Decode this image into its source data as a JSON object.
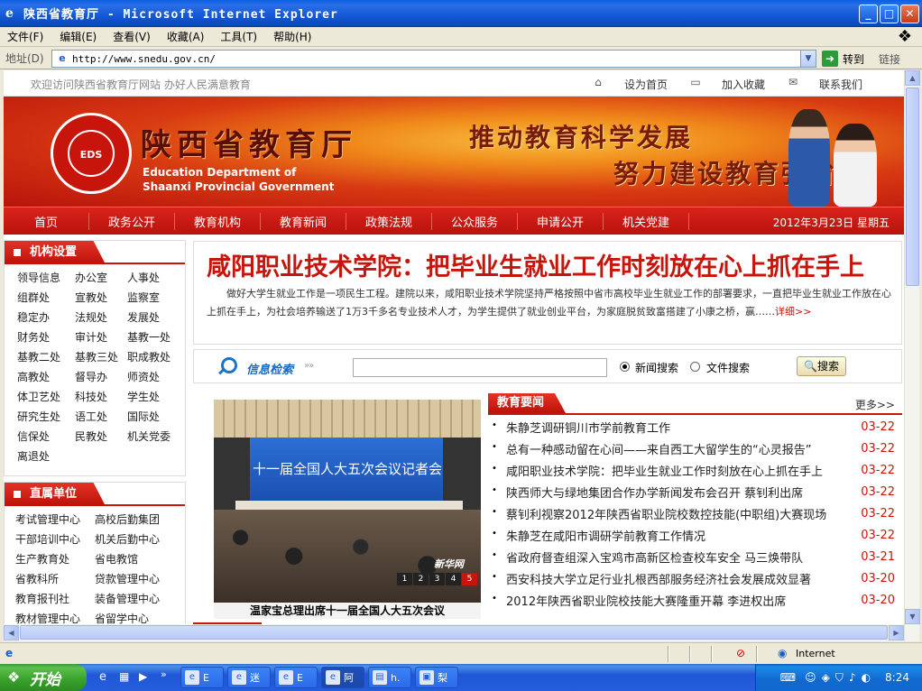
{
  "window": {
    "title": "陕西省教育厅 - Microsoft Internet Explorer",
    "menu": [
      "文件(F)",
      "编辑(E)",
      "查看(V)",
      "收藏(A)",
      "工具(T)",
      "帮助(H)"
    ],
    "address_label": "地址(D)",
    "url": "http://www.snedu.gov.cn/",
    "go_label": "转到",
    "links_label": "链接",
    "status_zone": "Internet"
  },
  "taskbar": {
    "start_label": "开始",
    "buttons": [
      {
        "icon": "ie-icon",
        "label": "E"
      },
      {
        "icon": "ie-icon",
        "label": "迷"
      },
      {
        "icon": "ie-icon",
        "label": "E"
      },
      {
        "icon": "ie-icon",
        "label": "阿"
      },
      {
        "icon": "doc-icon",
        "label": "h."
      },
      {
        "icon": "image-icon",
        "label": "梨"
      }
    ],
    "clock": "8:24"
  },
  "site": {
    "welcome": "欢迎访问陕西省教育厅网站 办好人民满意教育",
    "top_links": [
      "设为首页",
      "加入收藏",
      "联系我们"
    ],
    "name_cn": "陕西省教育厅",
    "name_en_line1": "Education Department of",
    "name_en_line2": "Shaanxi Provincial Government",
    "emblem_text": "EDS",
    "slogan_line1": "推动教育科学发展",
    "slogan_line2": "努力建设教育强省",
    "nav": [
      "首页",
      "政务公开",
      "教育机构",
      "教育新闻",
      "政策法规",
      "公众服务",
      "申请公开",
      "机关党建"
    ],
    "date": "2012年3月23日 星期五"
  },
  "sidebar": {
    "section1_title": "机构设置",
    "section1_items": [
      "领导信息",
      "办公室",
      "人事处",
      "组群处",
      "宣教处",
      "监察室",
      "稳定办",
      "法规处",
      "发展处",
      "财务处",
      "审计处",
      "基教一处",
      "基教二处",
      "基教三处",
      "职成教处",
      "高教处",
      "督导办",
      "师资处",
      "体卫艺处",
      "科技处",
      "学生处",
      "研究生处",
      "语工处",
      "国际处",
      "信保处",
      "民教处",
      "机关党委",
      "离退处"
    ],
    "section2_title": "直属单位",
    "section2_items": [
      "考试管理中心",
      "高校后勤集团",
      "干部培训中心",
      "机关后勤中心",
      "生产教育处",
      "省电教馆",
      "省教科所",
      "贷款管理中心",
      "教育报刊社",
      "装备管理中心",
      "教材管理中心",
      "省留学中心"
    ]
  },
  "headline": {
    "title": "咸阳职业技术学院：把毕业生就业工作时刻放在心上抓在手上",
    "summary": "做好大学生就业工作是一项民生工程。建院以来，咸阳职业技术学院坚持严格按照中省市高校毕业生就业工作的部署要求，一直把毕业生就业工作放在心上抓在手上，为社会培养输送了1万3千多名专业技术人才，为学生提供了就业创业平台，为家庭脱贫致富搭建了小康之桥，赢……",
    "more": "详细>>"
  },
  "search": {
    "label": "信息检索",
    "option1": "新闻搜索",
    "option2": "文件搜索",
    "button": "搜索"
  },
  "photo": {
    "backdrop_text": "十一届全国人大五次会议记者会",
    "watermark": "新华网",
    "pager": [
      "1",
      "2",
      "3",
      "4",
      "5"
    ],
    "caption": "温家宝总理出席十一届全国人大五次会议"
  },
  "news": {
    "title": "教育要闻",
    "more": "更多>>",
    "items": [
      {
        "title": "朱静芝调研铜川市学前教育工作",
        "date": "03-22"
      },
      {
        "title": "总有一种感动留在心间——来自西工大留学生的“心灵报告”",
        "date": "03-22"
      },
      {
        "title": "咸阳职业技术学院：把毕业生就业工作时刻放在心上抓在手上",
        "date": "03-22"
      },
      {
        "title": "陕西师大与绿地集团合作办学新闻发布会召开  蔡钊利出席",
        "date": "03-22"
      },
      {
        "title": "蔡钊利视察2012年陕西省职业院校数控技能(中职组)大赛现场",
        "date": "03-22"
      },
      {
        "title": "朱静芝在咸阳市调研学前教育工作情况",
        "date": "03-22"
      },
      {
        "title": "省政府督查组深入宝鸡市高新区检查校车安全  马三焕带队",
        "date": "03-21"
      },
      {
        "title": "西安科技大学立足行业扎根西部服务经济社会发展成效显著",
        "date": "03-20"
      },
      {
        "title": "2012年陕西省职业院校技能大赛隆重开幕  李进权出席",
        "date": "03-20"
      }
    ]
  }
}
